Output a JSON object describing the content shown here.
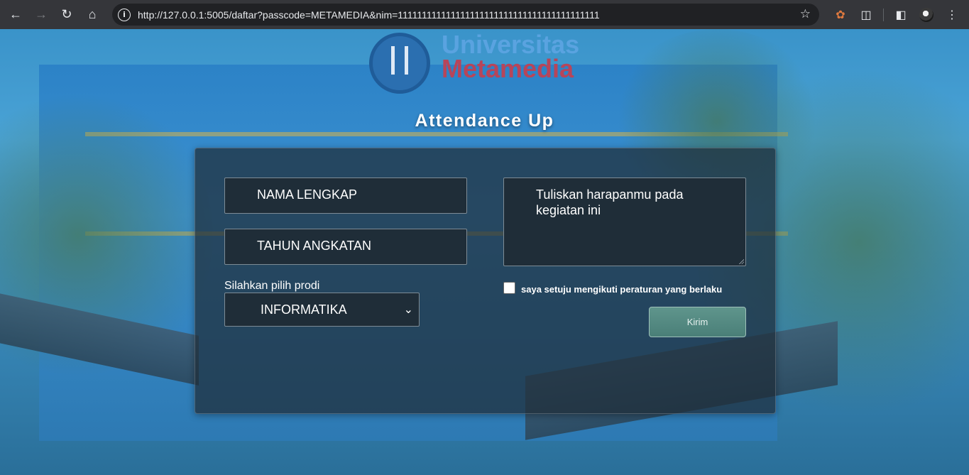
{
  "browser": {
    "url": "http://127.0.0.1:5005/daftar?passcode=METAMEDIA&nim=111111111111111111111111111111111111111111"
  },
  "background": {
    "sign_line1": "Universitas",
    "sign_line2": "Metamedia"
  },
  "app": {
    "title": "Attendance Up",
    "nama_placeholder": "NAMA LENGKAP",
    "tahun_placeholder": "TAHUN ANGKATAN",
    "prodi_label": "Silahkan pilih prodi",
    "prodi_selected": "INFORMATIKA",
    "harapan_placeholder": "Tuliskan harapanmu pada kegiatan ini",
    "agree_label": "saya setuju mengikuti peraturan yang berlaku",
    "agree_checked": false,
    "submit_label": "Kirim"
  },
  "colors": {
    "button": "#5a8f87",
    "card": "#1e2d37"
  }
}
